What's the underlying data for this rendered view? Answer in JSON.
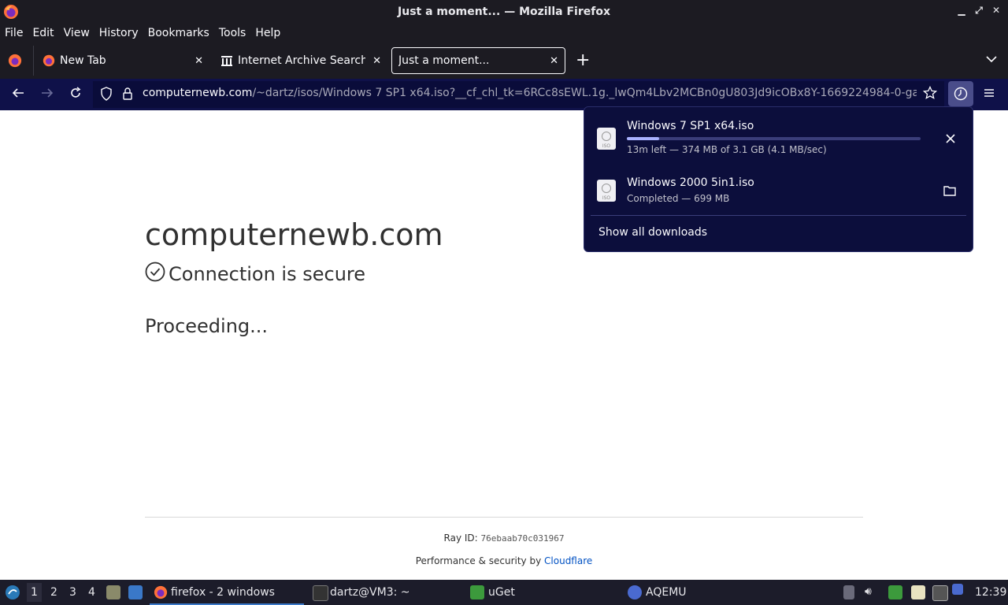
{
  "window": {
    "title": "Just a moment... — Mozilla Firefox"
  },
  "menubar": {
    "items": [
      "File",
      "Edit",
      "View",
      "History",
      "Bookmarks",
      "Tools",
      "Help"
    ]
  },
  "tabs": [
    {
      "label": "New Tab"
    },
    {
      "label": "Internet Archive Search:"
    },
    {
      "label": "Just a moment..."
    }
  ],
  "navbar": {
    "url_host": "computernewb.com",
    "url_path": "/~dartz/isos/Windows 7 SP1 x64.iso?__cf_chl_tk=6RCc8sEWL.1g._lwQm4Lbv2MCBn0gU803Jd9icOBx8Y-1669224984-0-ga"
  },
  "page": {
    "title": "computernewb.com",
    "secure": "Connection is secure",
    "status": "Proceeding...",
    "ray_label": "Ray ID:",
    "ray_id": "76ebaab70c031967",
    "perf_text": "Performance & security by",
    "perf_link": "Cloudflare"
  },
  "downloads": {
    "items": [
      {
        "name": "Windows 7 SP1 x64.iso",
        "status": "13m left — 374 MB of 3.1 GB (4.1 MB/sec)",
        "progress": 0.11,
        "icon_label": "ISO"
      },
      {
        "name": "Windows 2000 5in1.iso",
        "status": "Completed — 699 MB",
        "icon_label": "ISO"
      }
    ],
    "show_all": "Show all downloads"
  },
  "taskbar": {
    "workspaces": [
      "1",
      "2",
      "3",
      "4"
    ],
    "apps": [
      {
        "label": "firefox - 2 windows"
      },
      {
        "label": "dartz@VM3: ~"
      },
      {
        "label": "uGet"
      },
      {
        "label": "AQEMU"
      }
    ],
    "clock": "12:39"
  },
  "colors": {
    "accent": "#0f1149",
    "panel": "#0c0e3c",
    "progress": "#a9b1ff",
    "link": "#0051c3"
  }
}
